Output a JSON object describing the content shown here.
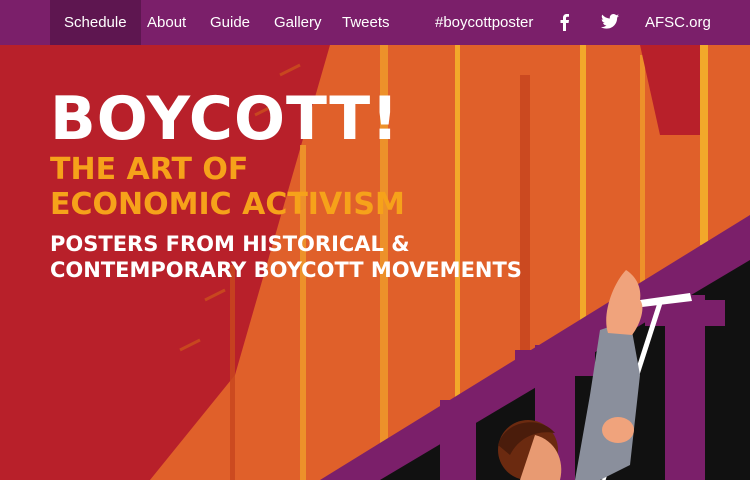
{
  "nav": {
    "items": [
      {
        "label": "Schedule"
      },
      {
        "label": "About"
      },
      {
        "label": "Guide"
      },
      {
        "label": "Gallery"
      },
      {
        "label": "Tweets"
      }
    ],
    "hashtag": "#boycottposter",
    "facebook_icon": "facebook-icon",
    "twitter_icon": "twitter-icon",
    "site_link": "AFSC.org"
  },
  "hero": {
    "title": "BOYCOTT!",
    "subtitle_lines": [
      "THE ART OF",
      "ECONOMIC ACTIVISM"
    ],
    "tagline_lines": [
      "POSTERS FROM HISTORICAL &",
      "CONTEMPORARY BOYCOTT MOVEMENTS"
    ]
  },
  "colors": {
    "nav_bg": "#7b1f6a",
    "nav_active_bg": "#5e1650",
    "poster_red": "#b8202a",
    "poster_orange": "#e0602a",
    "accent_yellow": "#f6a21a",
    "banner_purple": "#7b1f6a"
  }
}
